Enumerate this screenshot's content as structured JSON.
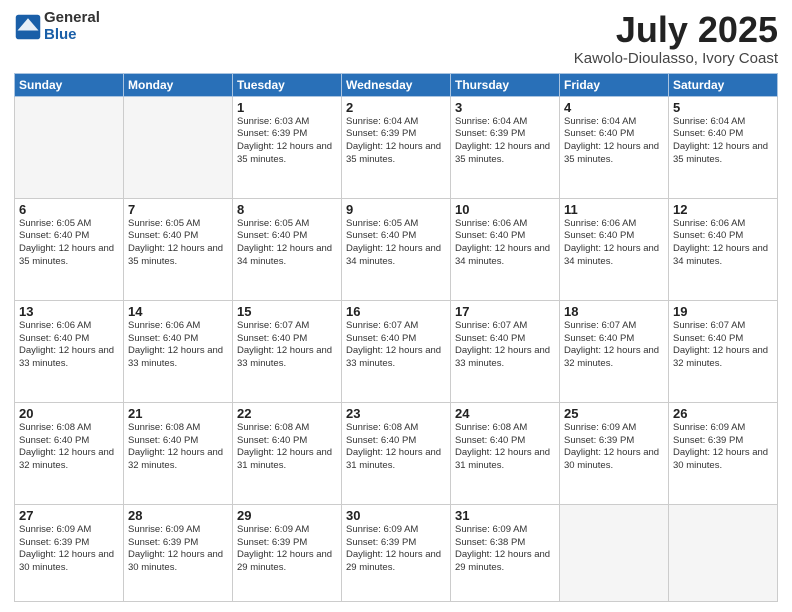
{
  "header": {
    "logo_general": "General",
    "logo_blue": "Blue",
    "month": "July 2025",
    "location": "Kawolo-Dioulasso, Ivory Coast"
  },
  "weekdays": [
    "Sunday",
    "Monday",
    "Tuesday",
    "Wednesday",
    "Thursday",
    "Friday",
    "Saturday"
  ],
  "weeks": [
    [
      {
        "day": "",
        "info": ""
      },
      {
        "day": "",
        "info": ""
      },
      {
        "day": "1",
        "info": "Sunrise: 6:03 AM\nSunset: 6:39 PM\nDaylight: 12 hours and 35 minutes."
      },
      {
        "day": "2",
        "info": "Sunrise: 6:04 AM\nSunset: 6:39 PM\nDaylight: 12 hours and 35 minutes."
      },
      {
        "day": "3",
        "info": "Sunrise: 6:04 AM\nSunset: 6:39 PM\nDaylight: 12 hours and 35 minutes."
      },
      {
        "day": "4",
        "info": "Sunrise: 6:04 AM\nSunset: 6:40 PM\nDaylight: 12 hours and 35 minutes."
      },
      {
        "day": "5",
        "info": "Sunrise: 6:04 AM\nSunset: 6:40 PM\nDaylight: 12 hours and 35 minutes."
      }
    ],
    [
      {
        "day": "6",
        "info": "Sunrise: 6:05 AM\nSunset: 6:40 PM\nDaylight: 12 hours and 35 minutes."
      },
      {
        "day": "7",
        "info": "Sunrise: 6:05 AM\nSunset: 6:40 PM\nDaylight: 12 hours and 35 minutes."
      },
      {
        "day": "8",
        "info": "Sunrise: 6:05 AM\nSunset: 6:40 PM\nDaylight: 12 hours and 34 minutes."
      },
      {
        "day": "9",
        "info": "Sunrise: 6:05 AM\nSunset: 6:40 PM\nDaylight: 12 hours and 34 minutes."
      },
      {
        "day": "10",
        "info": "Sunrise: 6:06 AM\nSunset: 6:40 PM\nDaylight: 12 hours and 34 minutes."
      },
      {
        "day": "11",
        "info": "Sunrise: 6:06 AM\nSunset: 6:40 PM\nDaylight: 12 hours and 34 minutes."
      },
      {
        "day": "12",
        "info": "Sunrise: 6:06 AM\nSunset: 6:40 PM\nDaylight: 12 hours and 34 minutes."
      }
    ],
    [
      {
        "day": "13",
        "info": "Sunrise: 6:06 AM\nSunset: 6:40 PM\nDaylight: 12 hours and 33 minutes."
      },
      {
        "day": "14",
        "info": "Sunrise: 6:06 AM\nSunset: 6:40 PM\nDaylight: 12 hours and 33 minutes."
      },
      {
        "day": "15",
        "info": "Sunrise: 6:07 AM\nSunset: 6:40 PM\nDaylight: 12 hours and 33 minutes."
      },
      {
        "day": "16",
        "info": "Sunrise: 6:07 AM\nSunset: 6:40 PM\nDaylight: 12 hours and 33 minutes."
      },
      {
        "day": "17",
        "info": "Sunrise: 6:07 AM\nSunset: 6:40 PM\nDaylight: 12 hours and 33 minutes."
      },
      {
        "day": "18",
        "info": "Sunrise: 6:07 AM\nSunset: 6:40 PM\nDaylight: 12 hours and 32 minutes."
      },
      {
        "day": "19",
        "info": "Sunrise: 6:07 AM\nSunset: 6:40 PM\nDaylight: 12 hours and 32 minutes."
      }
    ],
    [
      {
        "day": "20",
        "info": "Sunrise: 6:08 AM\nSunset: 6:40 PM\nDaylight: 12 hours and 32 minutes."
      },
      {
        "day": "21",
        "info": "Sunrise: 6:08 AM\nSunset: 6:40 PM\nDaylight: 12 hours and 32 minutes."
      },
      {
        "day": "22",
        "info": "Sunrise: 6:08 AM\nSunset: 6:40 PM\nDaylight: 12 hours and 31 minutes."
      },
      {
        "day": "23",
        "info": "Sunrise: 6:08 AM\nSunset: 6:40 PM\nDaylight: 12 hours and 31 minutes."
      },
      {
        "day": "24",
        "info": "Sunrise: 6:08 AM\nSunset: 6:40 PM\nDaylight: 12 hours and 31 minutes."
      },
      {
        "day": "25",
        "info": "Sunrise: 6:09 AM\nSunset: 6:39 PM\nDaylight: 12 hours and 30 minutes."
      },
      {
        "day": "26",
        "info": "Sunrise: 6:09 AM\nSunset: 6:39 PM\nDaylight: 12 hours and 30 minutes."
      }
    ],
    [
      {
        "day": "27",
        "info": "Sunrise: 6:09 AM\nSunset: 6:39 PM\nDaylight: 12 hours and 30 minutes."
      },
      {
        "day": "28",
        "info": "Sunrise: 6:09 AM\nSunset: 6:39 PM\nDaylight: 12 hours and 30 minutes."
      },
      {
        "day": "29",
        "info": "Sunrise: 6:09 AM\nSunset: 6:39 PM\nDaylight: 12 hours and 29 minutes."
      },
      {
        "day": "30",
        "info": "Sunrise: 6:09 AM\nSunset: 6:39 PM\nDaylight: 12 hours and 29 minutes."
      },
      {
        "day": "31",
        "info": "Sunrise: 6:09 AM\nSunset: 6:38 PM\nDaylight: 12 hours and 29 minutes."
      },
      {
        "day": "",
        "info": ""
      },
      {
        "day": "",
        "info": ""
      }
    ]
  ]
}
